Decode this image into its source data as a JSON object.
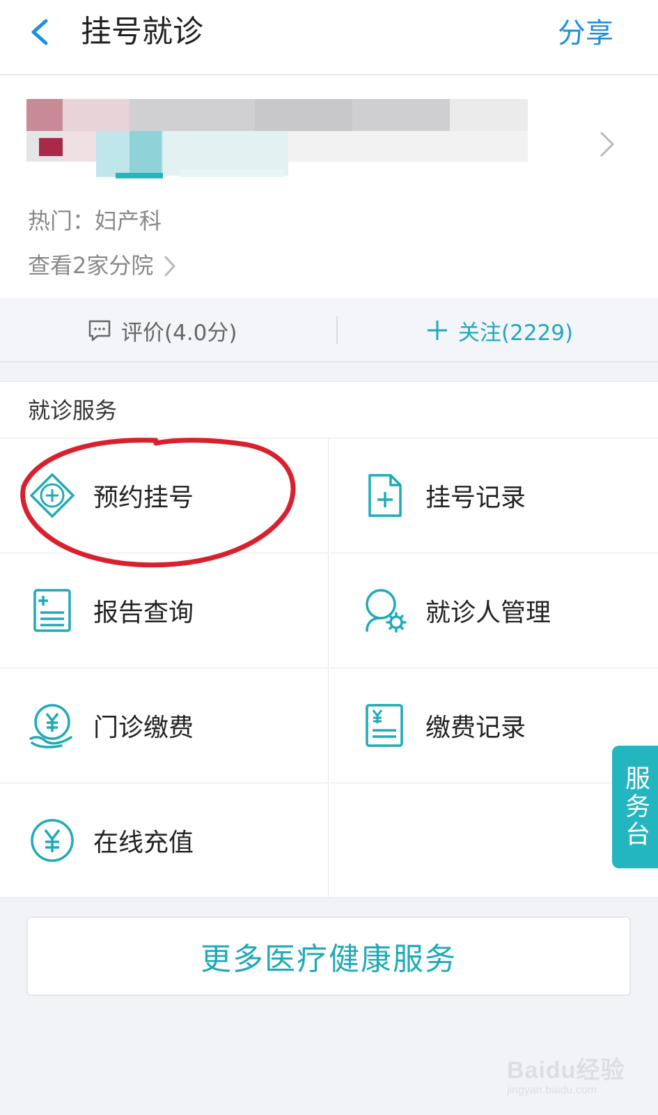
{
  "header": {
    "title": "挂号就诊",
    "share_label": "分享"
  },
  "hospital": {
    "hot_label": "热门：妇产科",
    "branches_label": "查看2家分院"
  },
  "actions": {
    "rating_label": "评价(4.0分)",
    "follow_label": "关注(2229)"
  },
  "services": {
    "section_title": "就诊服务",
    "items": [
      {
        "label": "预约挂号",
        "icon": "plus-diamond-icon"
      },
      {
        "label": "挂号记录",
        "icon": "document-plus-icon"
      },
      {
        "label": "报告查询",
        "icon": "report-icon"
      },
      {
        "label": "就诊人管理",
        "icon": "user-settings-icon"
      },
      {
        "label": "门诊缴费",
        "icon": "yuan-hand-icon"
      },
      {
        "label": "缴费记录",
        "icon": "yuan-document-icon"
      },
      {
        "label": "在线充值",
        "icon": "yuan-circle-icon"
      }
    ]
  },
  "more_services_label": "更多医疗健康服务",
  "service_desk_label": "服务台",
  "watermark": {
    "brand": "Baidu经验",
    "url": "jingyan.baidu.com"
  },
  "colors": {
    "accent": "#1faab7",
    "link_blue": "#1e8fe0",
    "annotation_red": "#d9202e"
  }
}
